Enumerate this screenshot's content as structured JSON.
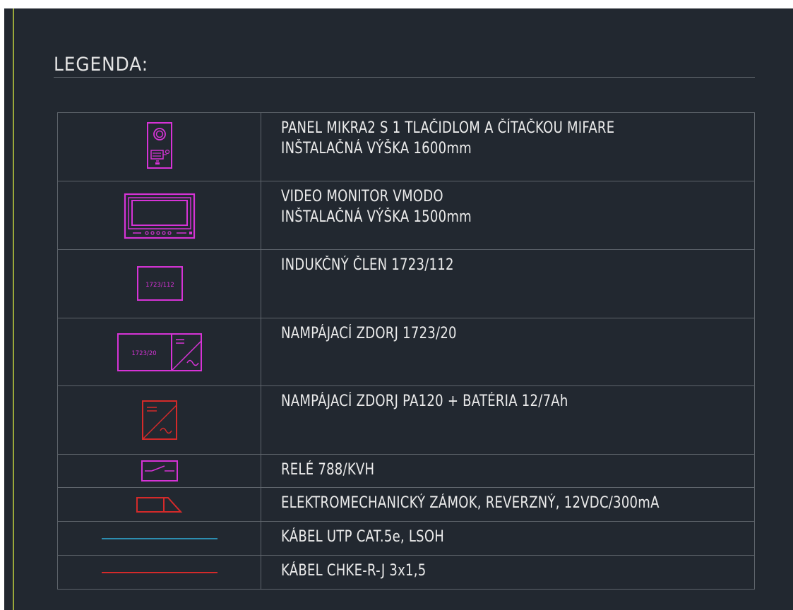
{
  "title": "LEGENDA:",
  "colors": {
    "background": "#222830",
    "text": "#ebebeb",
    "magenta": "#d633d6",
    "red": "#d42a2a",
    "cyan": "#2c8db0",
    "grid": "#5e646b",
    "frame_line": "#9aa83a"
  },
  "rows": [
    {
      "symbol": "door-panel-icon",
      "lines": [
        "PANEL MIKRA2 S 1 TLAČIDLOM A ČÍTAČKOU MIFARE",
        "INŠTALAČNÁ VÝŠKA 1600mm"
      ]
    },
    {
      "symbol": "video-monitor-icon",
      "lines": [
        "VIDEO MONITOR VMODO",
        "INŠTALAČNÁ VÝŠKA 1500mm"
      ]
    },
    {
      "symbol": "induction-loop-icon",
      "symbol_text": "1723/112",
      "lines": [
        "INDUKČNÝ ČLEN 1723/112"
      ]
    },
    {
      "symbol": "power-supply-icon",
      "symbol_text": "1723/20",
      "lines": [
        "NAMPÁJACÍ ZDORJ 1723/20"
      ]
    },
    {
      "symbol": "power-supply-battery-icon",
      "lines": [
        "NAMPÁJACÍ ZDORJ PA120 + BATÉRIA 12/7Ah"
      ]
    },
    {
      "symbol": "relay-icon",
      "lines": [
        "RELÉ 788/KVH"
      ]
    },
    {
      "symbol": "electromechanical-lock-icon",
      "lines": [
        "ELEKTROMECHANICKÝ ZÁMOK, REVERZNÝ, 12VDC/300mA"
      ]
    },
    {
      "symbol": "utp-cable-line-icon",
      "lines": [
        "KÁBEL UTP CAT.5e, LSOH"
      ]
    },
    {
      "symbol": "chke-cable-line-icon",
      "lines": [
        "KÁBEL CHKE-R-J 3x1,5"
      ]
    }
  ]
}
